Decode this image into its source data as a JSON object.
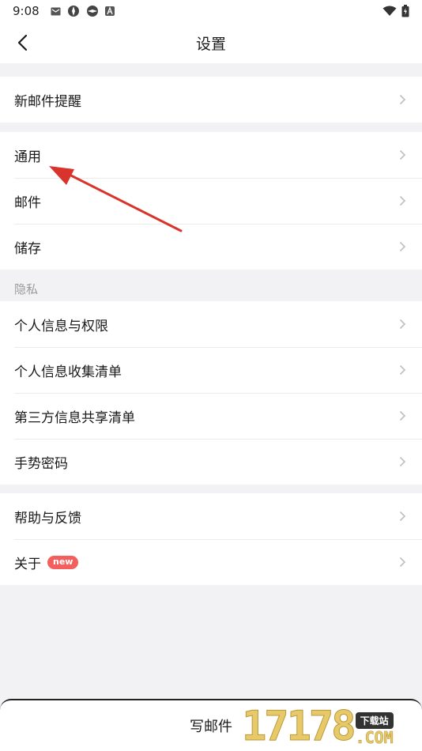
{
  "status_bar": {
    "time": "9:08"
  },
  "nav": {
    "title": "设置"
  },
  "groups": [
    {
      "items": [
        "新邮件提醒"
      ]
    },
    {
      "items": [
        "通用",
        "邮件",
        "储存"
      ]
    },
    {
      "label": "隐私",
      "items": [
        "个人信息与权限",
        "个人信息收集清单",
        "第三方信息共享清单",
        "手势密码"
      ]
    },
    {
      "items": [
        "帮助与反馈",
        "关于"
      ]
    }
  ],
  "about_badge": "new",
  "compose": {
    "label": "写邮件"
  },
  "watermark": {
    "number": "17178",
    "tag": "下载站",
    "suffix": ".COM"
  },
  "colors": {
    "badge": "#f25f5c",
    "arrow": "#d9342b",
    "background": "#f2f2f4"
  }
}
